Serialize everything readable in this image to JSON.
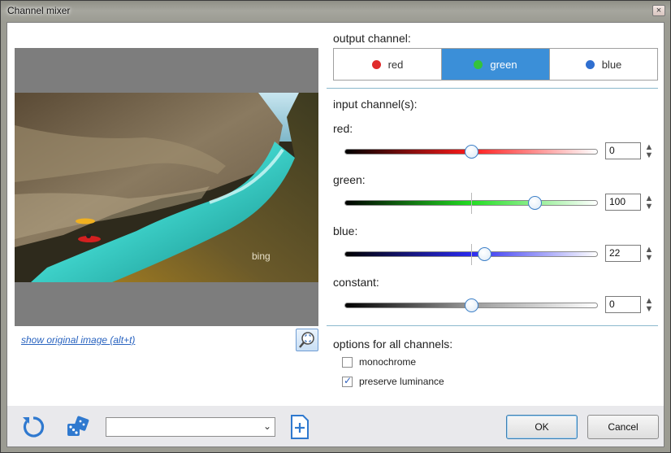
{
  "window": {
    "title": "Channel mixer",
    "close_glyph": "×"
  },
  "preview": {
    "show_original_link": "show original image (alt+t)",
    "watermark": "bing",
    "zoom_icon": "zoom-fit-icon"
  },
  "output": {
    "label": "output channel:",
    "options": [
      {
        "label": "red",
        "color": "#e02b2b",
        "active": false
      },
      {
        "label": "green",
        "color": "#34c33a",
        "active": true
      },
      {
        "label": "blue",
        "color": "#2f6fd0",
        "active": false
      }
    ]
  },
  "input": {
    "label": "input channel(s):",
    "channels": [
      {
        "label": "red:",
        "value": "0",
        "fraction": 0.5,
        "color": "#ff2020"
      },
      {
        "label": "green:",
        "value": "100",
        "fraction": 0.75,
        "color": "#22dd22"
      },
      {
        "label": "blue:",
        "value": "22",
        "fraction": 0.55,
        "color": "#2a2af0"
      },
      {
        "label": "constant:",
        "value": "0",
        "fraction": 0.5,
        "color": "#9a9a9a"
      }
    ]
  },
  "options": {
    "label": "options for all channels:",
    "monochrome": {
      "label": "monochrome",
      "checked": false
    },
    "preserve": {
      "label": "preserve luminance",
      "checked": true,
      "check_glyph": "✓"
    }
  },
  "bottom": {
    "reset_icon": "reset-icon",
    "random_icon": "dice-icon",
    "preset_value": "",
    "add_preset_icon": "add-preset-icon",
    "ok": "OK",
    "cancel": "Cancel"
  }
}
